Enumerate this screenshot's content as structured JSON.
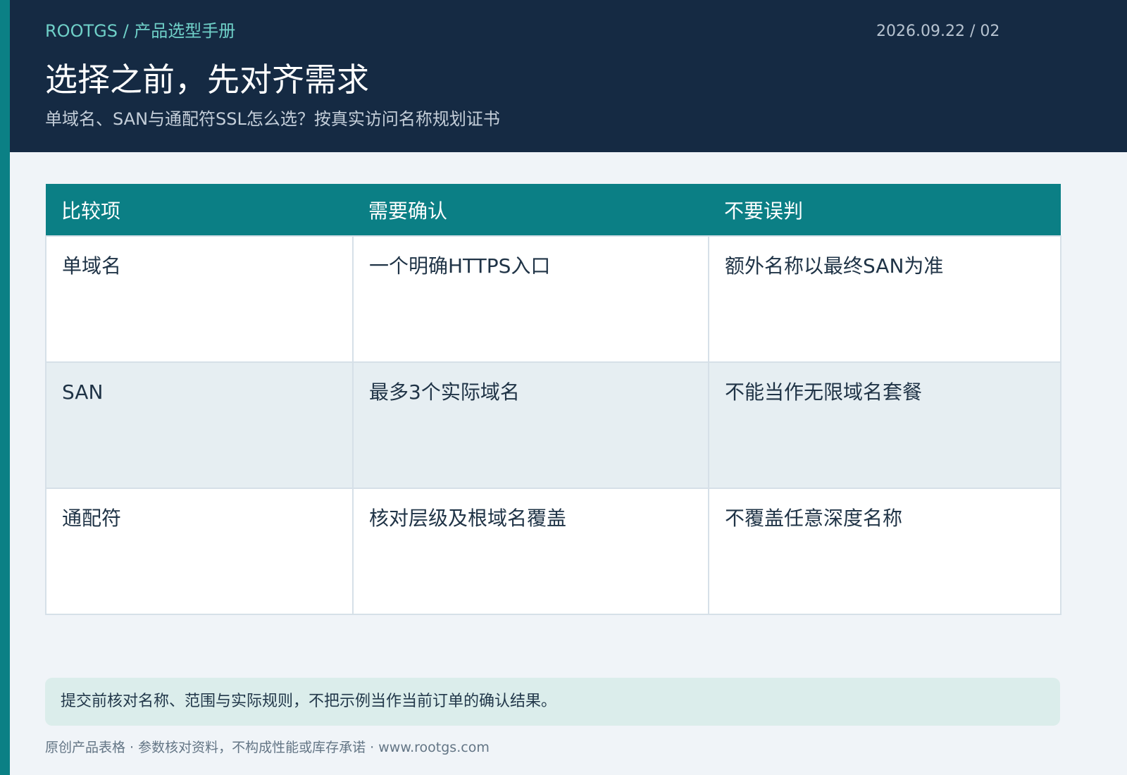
{
  "header": {
    "brand": "ROOTGS / 产品选型手册",
    "date": "2026.09.22 / 02",
    "title": "选择之前，先对齐需求",
    "subtitle": "单域名、SAN与通配符SSL怎么选？按真实访问名称规划证书"
  },
  "table": {
    "columns": [
      "比较项",
      "需要确认",
      "不要误判"
    ],
    "rows": [
      [
        "单域名",
        "一个明确HTTPS入口",
        "额外名称以最终SAN为准"
      ],
      [
        "SAN",
        "最多3个实际域名",
        "不能当作无限域名套餐"
      ],
      [
        "通配符",
        "核对层级及根域名覆盖",
        "不覆盖任意深度名称"
      ]
    ]
  },
  "note": "提交前核对名称、范围与实际规则，不把示例当作当前订单的确认结果。",
  "footer": "原创产品表格 · 参数核对资料，不构成性能或库存承诺 · www.rootgs.com",
  "colors": {
    "accent": "#0b8085",
    "header_bg": "#152a43",
    "brand": "#6fd0c8",
    "table_header": "#0b7f85",
    "row_alt": "#e6eef2",
    "note_bg": "#dbedeb",
    "page_bg": "#f0f4f8"
  }
}
